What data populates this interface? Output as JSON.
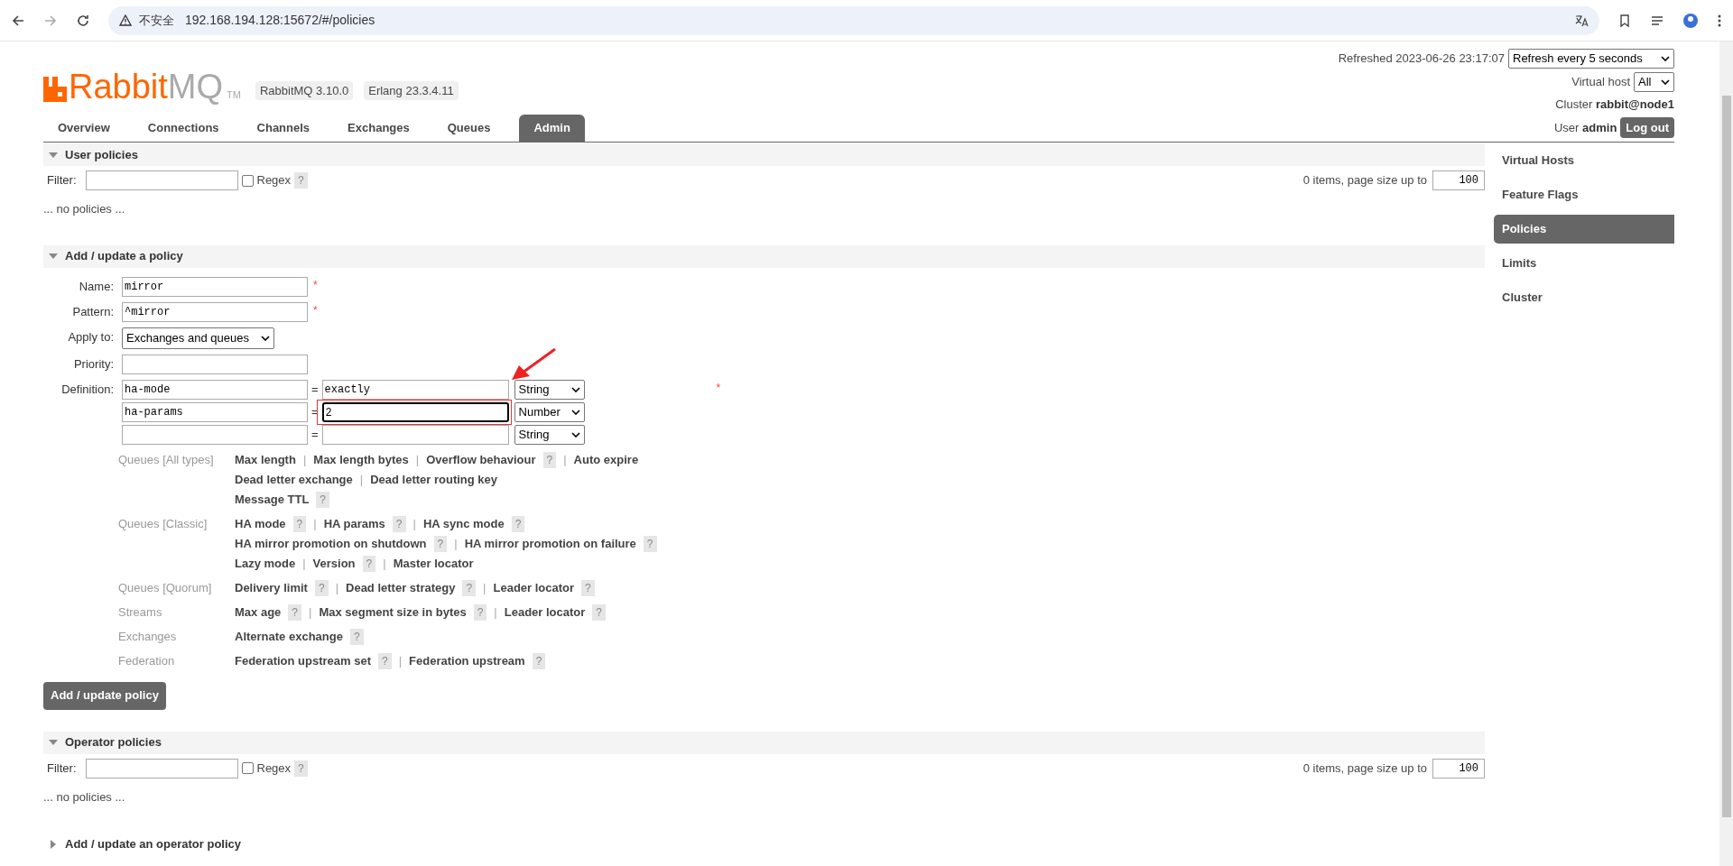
{
  "browser": {
    "security_label": "不安全",
    "url": "192.168.194.128:15672/#/policies"
  },
  "header": {
    "logo_main": "Rabbit",
    "logo_accent": "MQ",
    "logo_tm": "TM",
    "badges": [
      "RabbitMQ 3.10.0",
      "Erlang 23.3.4.11"
    ],
    "refreshed": "Refreshed 2023-06-26 23:17:07",
    "refresh_select": "Refresh every 5 seconds",
    "vhost_label": "Virtual host",
    "vhost_select": "All",
    "cluster_label": "Cluster",
    "cluster_value": "rabbit@node1",
    "user_label": "User",
    "user_value": "admin",
    "logout": "Log out"
  },
  "tabs": [
    {
      "label": "Overview",
      "selected": false
    },
    {
      "label": "Connections",
      "selected": false
    },
    {
      "label": "Channels",
      "selected": false
    },
    {
      "label": "Exchanges",
      "selected": false
    },
    {
      "label": "Queues",
      "selected": false
    },
    {
      "label": "Admin",
      "selected": true
    }
  ],
  "sidebar": {
    "items": [
      {
        "label": "Virtual Hosts",
        "selected": false
      },
      {
        "label": "Feature Flags",
        "selected": false
      },
      {
        "label": "Policies",
        "selected": true
      },
      {
        "label": "Limits",
        "selected": false
      },
      {
        "label": "Cluster",
        "selected": false
      }
    ]
  },
  "sections": [
    {
      "kind": "list",
      "title": "User policies",
      "expanded": true,
      "filter_label": "Filter:",
      "regex_label": "Regex",
      "regex_checked": false,
      "help": "?",
      "count_text": "0 items, page size up to",
      "page_size": "100",
      "empty_text": "... no policies ..."
    },
    {
      "kind": "form",
      "title": "Add / update a policy",
      "expanded": true,
      "required_mark": "*",
      "separator": "|",
      "help": "?",
      "fields": [
        {
          "label": "Name:",
          "value": "mirror",
          "required": true
        },
        {
          "label": "Pattern:",
          "value": "^mirror",
          "required": true
        }
      ],
      "apply_to": {
        "label": "Apply to:",
        "value": "Exchanges and queues"
      },
      "priority": {
        "label": "Priority:"
      },
      "definition": {
        "label": "Definition:",
        "equals": "=",
        "required": true,
        "rows": [
          {
            "key": "ha-mode",
            "value": "exactly",
            "type": "String",
            "highlighted": false
          },
          {
            "key": "ha-params",
            "value": "2",
            "type": "Number",
            "highlighted": true
          },
          {
            "type": "String",
            "highlighted": false
          }
        ]
      },
      "help_groups": [
        {
          "label": "Queues [All types]",
          "lines": [
            [
              {
                "text": "Max length",
                "help": false
              },
              {
                "text": "Max length bytes",
                "help": false
              },
              {
                "text": "Overflow behaviour",
                "help": true
              },
              {
                "text": "Auto expire",
                "help": false
              }
            ],
            [
              {
                "text": "Dead letter exchange",
                "help": false
              },
              {
                "text": "Dead letter routing key",
                "help": false
              }
            ],
            [
              {
                "text": "Message TTL",
                "help": true
              }
            ]
          ]
        },
        {
          "label": "Queues [Classic]",
          "lines": [
            [
              {
                "text": "HA mode",
                "help": true
              },
              {
                "text": "HA params",
                "help": true
              },
              {
                "text": "HA sync mode",
                "help": true
              }
            ],
            [
              {
                "text": "HA mirror promotion on shutdown",
                "help": true
              },
              {
                "text": "HA mirror promotion on failure",
                "help": true
              }
            ],
            [
              {
                "text": "Lazy mode",
                "help": false
              },
              {
                "text": "Version",
                "help": true
              },
              {
                "text": "Master locator",
                "help": false
              }
            ]
          ]
        },
        {
          "label": "Queues [Quorum]",
          "lines": [
            [
              {
                "text": "Delivery limit",
                "help": true
              },
              {
                "text": "Dead letter strategy",
                "help": true
              },
              {
                "text": "Leader locator",
                "help": true
              }
            ]
          ]
        },
        {
          "label": "Streams",
          "lines": [
            [
              {
                "text": "Max age",
                "help": true
              },
              {
                "text": "Max segment size in bytes",
                "help": true
              },
              {
                "text": "Leader locator",
                "help": true
              }
            ]
          ]
        },
        {
          "label": "Exchanges",
          "lines": [
            [
              {
                "text": "Alternate exchange",
                "help": true
              }
            ]
          ]
        },
        {
          "label": "Federation",
          "lines": [
            [
              {
                "text": "Federation upstream set",
                "help": true
              },
              {
                "text": "Federation upstream",
                "help": true
              }
            ]
          ]
        }
      ],
      "submit": "Add / update policy"
    },
    {
      "kind": "list",
      "title": "Operator policies",
      "expanded": true,
      "filter_label": "Filter:",
      "regex_label": "Regex",
      "regex_checked": false,
      "help": "?",
      "count_text": "0 items, page size up to",
      "page_size": "100",
      "empty_text": "... no policies ..."
    },
    {
      "title": "Add / update an operator policy",
      "expanded": false
    }
  ]
}
